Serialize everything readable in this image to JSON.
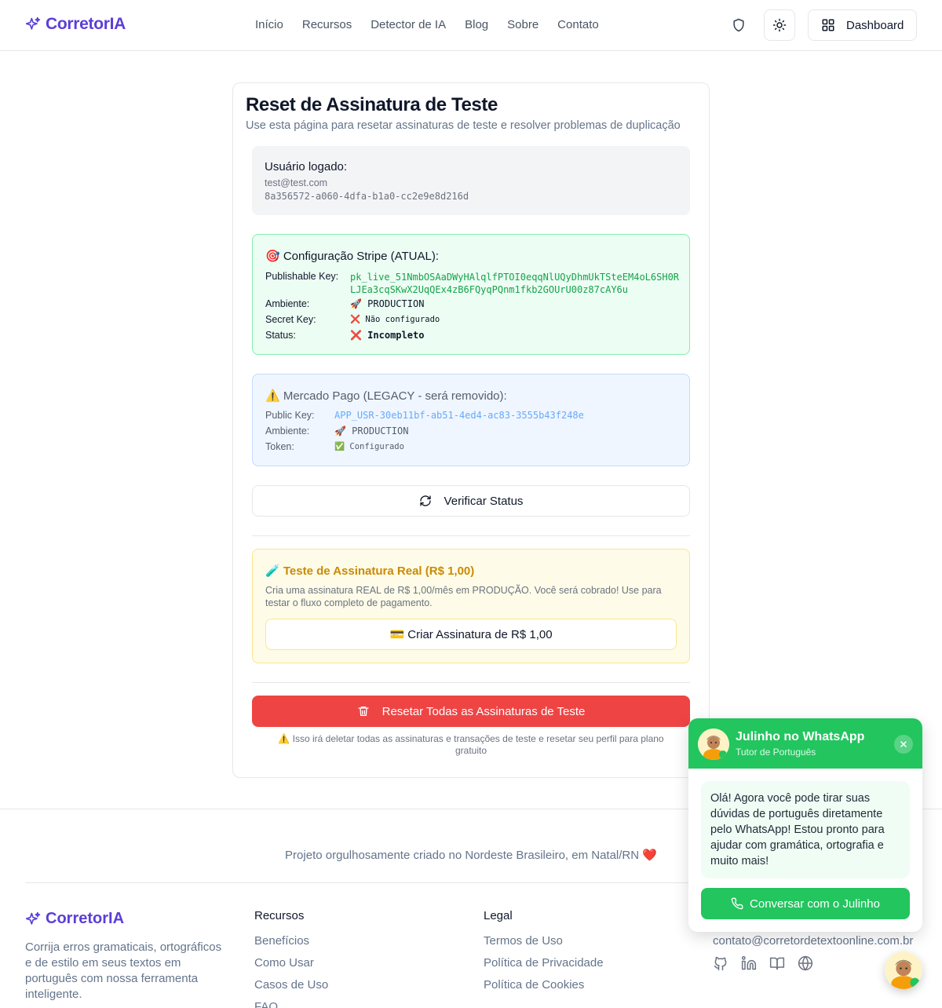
{
  "header": {
    "brand": "CorretorIA",
    "nav": [
      "Início",
      "Recursos",
      "Detector de IA",
      "Blog",
      "Sobre",
      "Contato"
    ],
    "dashboard_label": "Dashboard"
  },
  "card": {
    "title": "Reset de Assinatura de Teste",
    "subtitle": "Use esta página para resetar assinaturas de teste e resolver problemas de duplicação",
    "user": {
      "label": "Usuário logado:",
      "email": "test@test.com",
      "id": "8a356572-a060-4dfa-b1a0-cc2e9e8d216d"
    },
    "stripe": {
      "title": "🎯 Configuração Stripe (ATUAL):",
      "publishable_label": "Publishable Key:",
      "publishable_value": "pk_live_51NmbOSAaDWyHAlqlfPTOI0eqqNlUQyDhmUkTSteEM4oL6SH0RLJEa3cqSKwX2UqQEx4zB6FQyqPQnm1fkb2GOUrU00z87cAY6u",
      "ambiente_label": "Ambiente:",
      "ambiente_value": "🚀 PRODUCTION",
      "secret_label": "Secret Key:",
      "secret_value": "❌ Não configurado",
      "status_label": "Status:",
      "status_value": "❌ Incompleto"
    },
    "mercado_pago": {
      "title": "⚠️ Mercado Pago (LEGACY - será removido):",
      "public_label": "Public Key:",
      "public_value": "APP_USR-30eb11bf-ab51-4ed4-ac83-3555b43f248e",
      "ambiente_label": "Ambiente:",
      "ambiente_value": "🚀 PRODUCTION",
      "token_label": "Token:",
      "token_value": "✅ Configurado"
    },
    "verify_label": "Verificar Status",
    "test": {
      "title": "🧪 Teste de Assinatura Real (R$ 1,00)",
      "description": "Cria uma assinatura REAL de R$ 1,00/mês em PRODUÇÃO. Você será cobrado! Use para testar o fluxo completo de pagamento.",
      "button": "💳 Criar Assinatura de R$ 1,00"
    },
    "reset_label": "Resetar Todas as Assinaturas de Teste",
    "warning": "⚠️ Isso irá deletar todas as assinaturas e transações de teste e resetar seu perfil para plano gratuito"
  },
  "footer": {
    "proud": "Projeto orgulhosamente criado no Nordeste Brasileiro, em Natal/RN ❤️",
    "brand": "CorretorIA",
    "description": "Corrija erros gramaticais, ortográficos e de estilo em seus textos em português com nossa ferramenta inteligente.",
    "recursos_title": "Recursos",
    "recursos": [
      "Benefícios",
      "Como Usar",
      "Casos de Uso",
      "FAQ"
    ],
    "legal_title": "Legal",
    "legal": [
      "Termos de Uso",
      "Política de Privacidade",
      "Política de Cookies"
    ],
    "contact_email": "contato@corretordetextoonline.com.br"
  },
  "whatsapp": {
    "name": "Julinho no WhatsApp",
    "role": "Tutor de Português",
    "message": "Olá! Agora você pode tirar suas dúvidas de português diretamente pelo WhatsApp! Estou pronto para ajudar com gramática, ortografia e muito mais!",
    "button": "Conversar com o Julinho"
  },
  "colors": {
    "brand": "#5b3fd6",
    "danger": "#ef4444",
    "whatsapp": "#22c55e",
    "stripe_bg": "#ecfdf3",
    "legacy_bg": "#eff6ff",
    "test_bg": "#fefce8"
  }
}
